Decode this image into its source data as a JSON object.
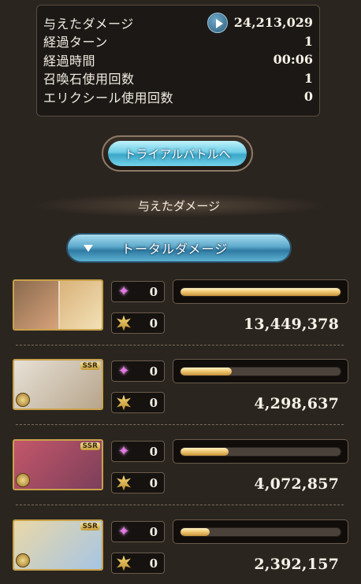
{
  "summary": {
    "damage_label": "与えたダメージ",
    "damage_value": "24,213,029",
    "turns_label": "経過ターン",
    "turns_value": "1",
    "time_label": "経過時間",
    "time_value": "00:06",
    "summon_label": "召喚石使用回数",
    "summon_value": "1",
    "elixir_label": "エリクシール使用回数",
    "elixir_value": "0"
  },
  "trial_button": {
    "label": "トライアルバトルへ"
  },
  "section": {
    "title": "与えたダメージ"
  },
  "dropdown": {
    "label": "トータルダメージ"
  },
  "characters": [
    {
      "star": "0",
      "cross": "0",
      "damage": "13,449,378",
      "share": 1.0,
      "ssr": "",
      "colors": [
        "#8a6a4e",
        "#d9b27a"
      ]
    },
    {
      "star": "0",
      "cross": "0",
      "damage": "4,298,637",
      "share": 0.32,
      "ssr": "SSR",
      "colors": [
        "#e7e1d6",
        "#b7a58c"
      ]
    },
    {
      "star": "0",
      "cross": "0",
      "damage": "4,072,857",
      "share": 0.3,
      "ssr": "SSR",
      "colors": [
        "#c4576a",
        "#7b3f5a"
      ]
    },
    {
      "star": "0",
      "cross": "0",
      "damage": "2,392,157",
      "share": 0.18,
      "ssr": "SSR",
      "colors": [
        "#e9d8a8",
        "#a7c5e4"
      ]
    }
  ]
}
